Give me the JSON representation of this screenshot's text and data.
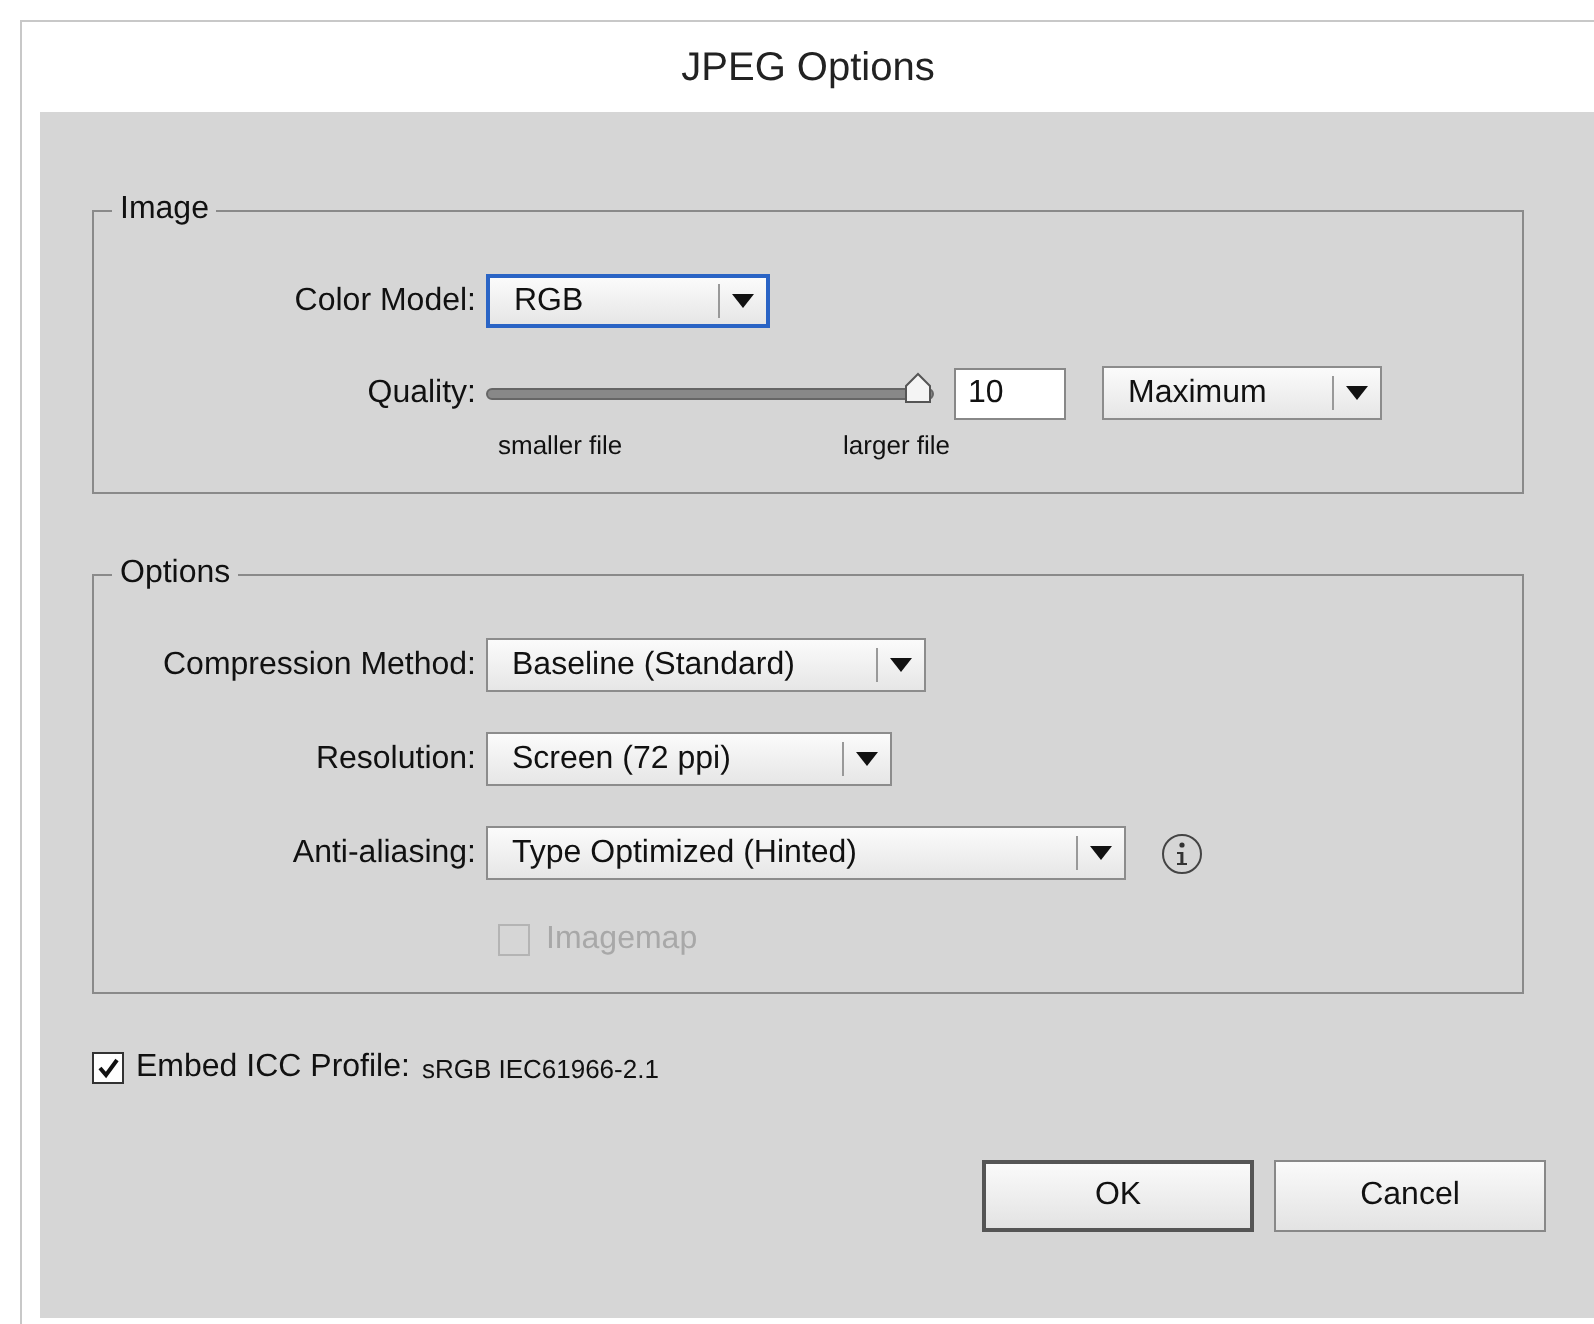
{
  "window": {
    "title": "JPEG Options"
  },
  "image_group": {
    "title": "Image",
    "color_model": {
      "label": "Color Model:",
      "value": "RGB",
      "focused": true
    },
    "quality": {
      "label": "Quality:",
      "level": 1,
      "value": "10",
      "min_label": "smaller file",
      "max_label": "larger file",
      "preset": "Maximum"
    }
  },
  "options_group": {
    "title": "Options",
    "rows": [
      {
        "label": "Compression Method:",
        "value": "Baseline (Standard)",
        "info": false
      },
      {
        "label": "Resolution:",
        "value": "Screen (72 ppi)",
        "info": false
      },
      {
        "label": "Anti-aliasing:",
        "value": "Type Optimized (Hinted)",
        "info": true
      }
    ],
    "imagemap": {
      "label": "Imagemap",
      "checked": false,
      "disabled": true
    }
  },
  "embed_icc": {
    "label": "Embed ICC Profile:",
    "profile": "sRGB IEC61966-2.1",
    "checked": true
  },
  "buttons": [
    {
      "label": "OK",
      "default": true
    },
    {
      "label": "Cancel",
      "default": false
    }
  ]
}
